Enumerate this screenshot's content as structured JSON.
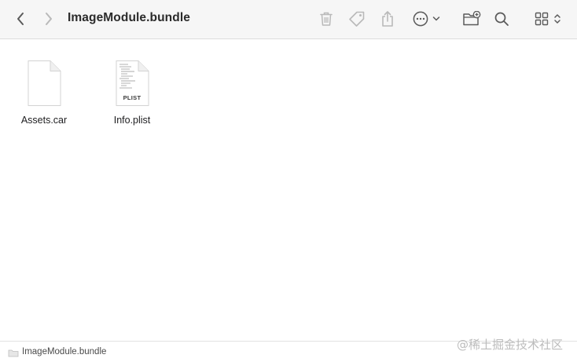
{
  "window": {
    "title": "ImageModule.bundle"
  },
  "toolbar": {
    "back_icon": "chevron-left-icon",
    "forward_icon": "chevron-right-icon",
    "trash_icon": "trash-icon",
    "tag_icon": "tag-icon",
    "share_icon": "share-icon",
    "more_icon": "ellipsis-circle-icon",
    "new_folder_icon": "folder-badge-plus-icon",
    "search_icon": "search-icon",
    "view_icon": "grid-view-icon"
  },
  "files": [
    {
      "name": "Assets.car",
      "kind": "generic-document"
    },
    {
      "name": "Info.plist",
      "kind": "plist",
      "badge": "PLIST"
    }
  ],
  "statusbar": {
    "path": "ImageModule.bundle"
  },
  "watermark": {
    "text": "@稀土掘金技术社区"
  },
  "colors": {
    "toolbar_bg": "#f6f6f6",
    "icon_active": "#5a5a5a",
    "icon_disabled": "#b9b9b9"
  }
}
